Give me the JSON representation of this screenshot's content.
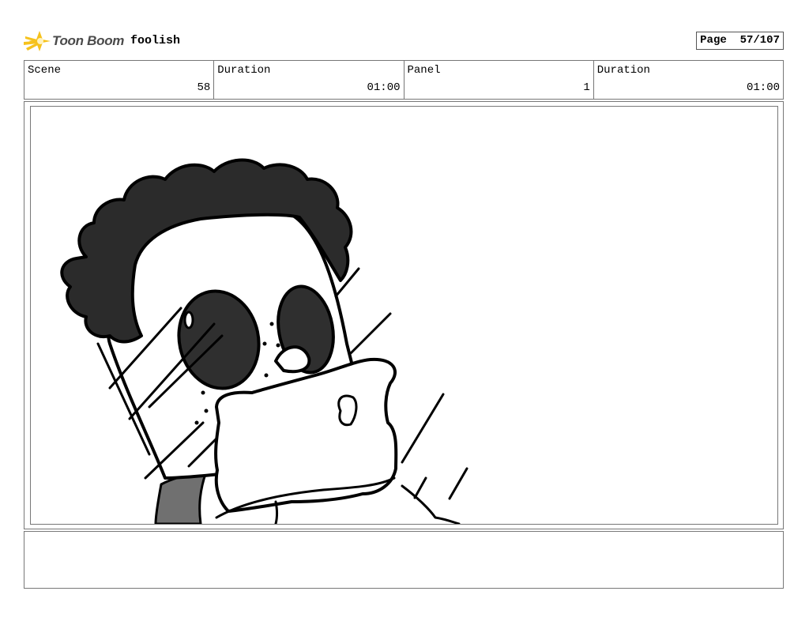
{
  "header": {
    "logo_text": "Toon Boom",
    "project_name": "foolish",
    "page_label": "Page",
    "page_value": "57/107"
  },
  "info": {
    "scene_label": "Scene",
    "scene_value": "58",
    "scene_duration_label": "Duration",
    "scene_duration_value": "01:00",
    "panel_label": "Panel",
    "panel_value": "1",
    "panel_duration_label": "Duration",
    "panel_duration_value": "01:00"
  },
  "notes": {
    "text": ""
  },
  "colors": {
    "logo_accent": "#f6c21c",
    "hair": "#2b2b2b",
    "eyes": "#2f2f2f",
    "collar": "#707070"
  }
}
